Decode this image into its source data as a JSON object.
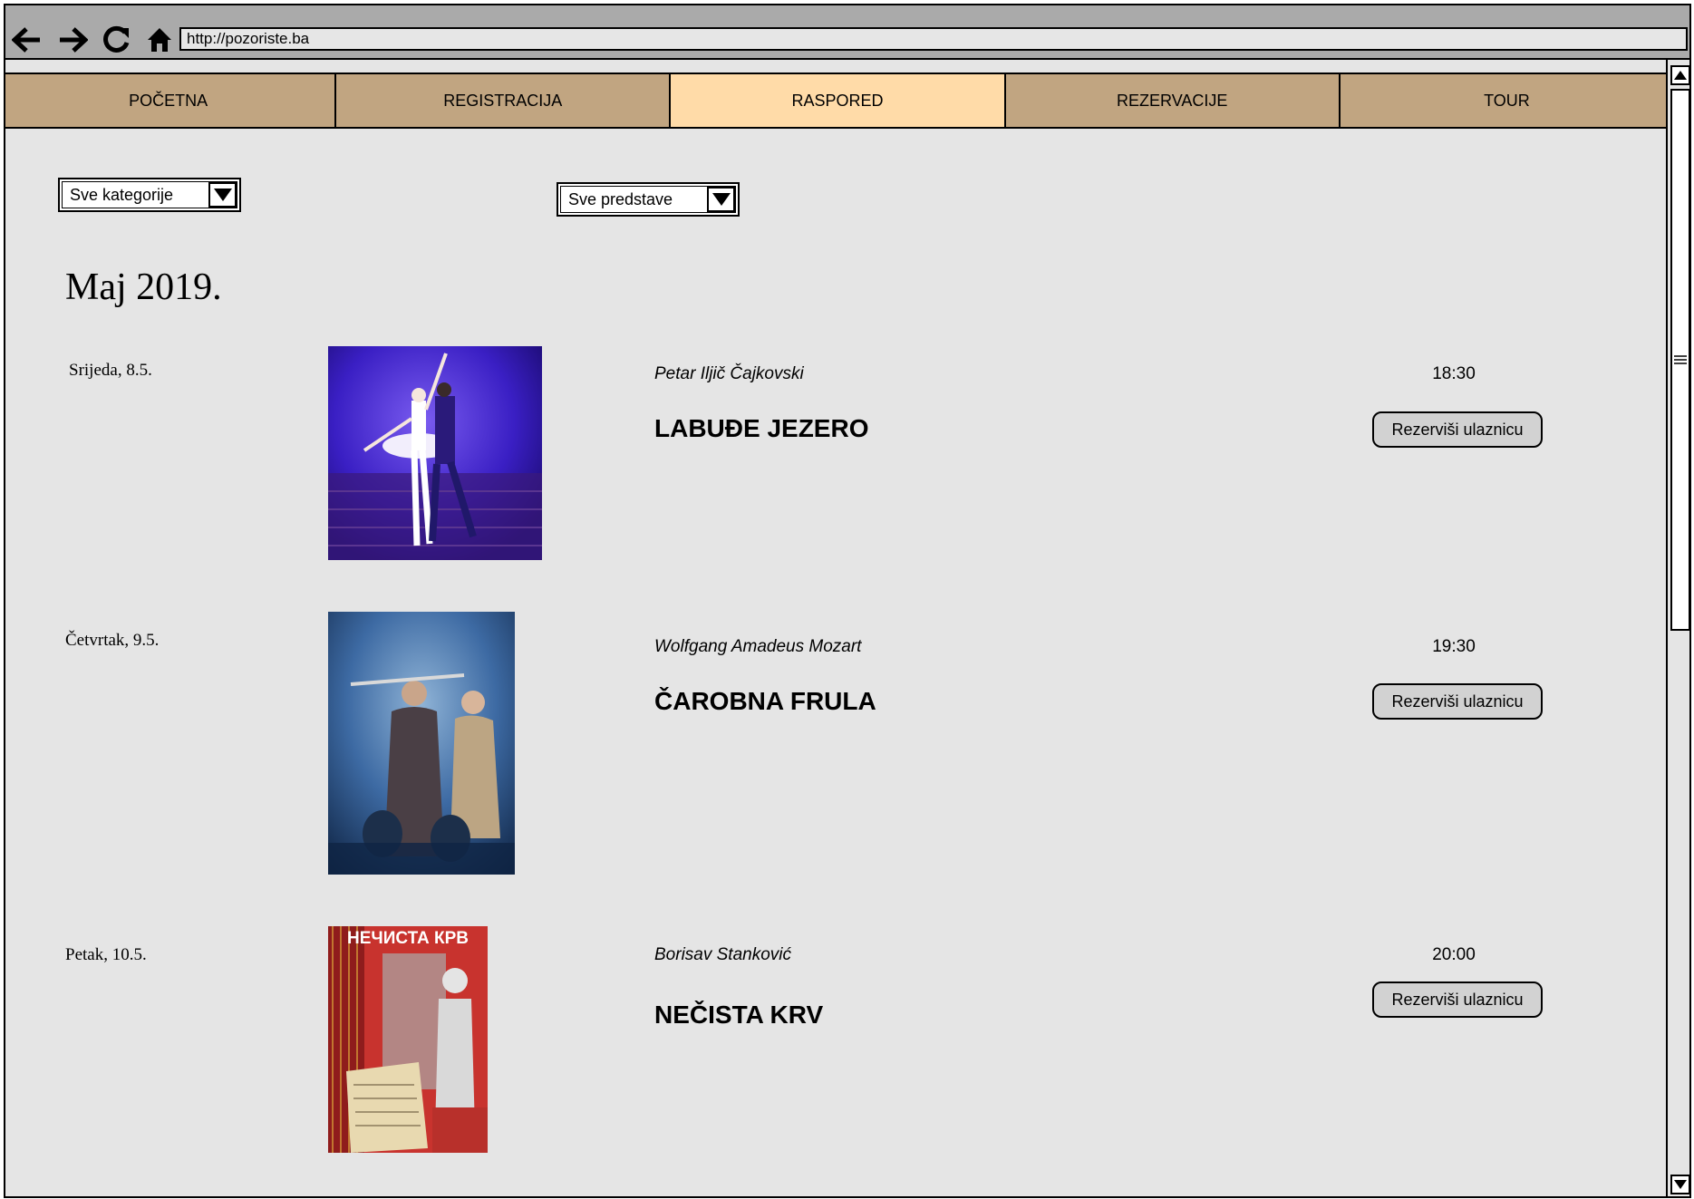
{
  "browser": {
    "url": "http://pozoriste.ba",
    "icons": [
      "back-arrow-icon",
      "forward-arrow-icon",
      "reload-icon",
      "home-icon"
    ]
  },
  "menu": {
    "tabs": [
      {
        "label": "POČETNA",
        "active": false
      },
      {
        "label": "REGISTRACIJA",
        "active": false
      },
      {
        "label": "RASPORED",
        "active": true
      },
      {
        "label": "REZERVACIJE",
        "active": false
      },
      {
        "label": "TOUR",
        "active": false
      }
    ]
  },
  "filters": {
    "category": "Sve kategorije",
    "show": "Sve predstave"
  },
  "month": "Maj 2019.",
  "events": [
    {
      "date": "Srijeda, 8.5.",
      "author": "Petar Iljič Čajkovski",
      "title": "LABUĐE JEZERO",
      "time": "18:30",
      "button": "Rezerviši ulaznicu"
    },
    {
      "date": "Četvrtak, 9.5.",
      "author": "Wolfgang Amadeus Mozart",
      "title": "ČAROBNA FRULA",
      "time": "19:30",
      "button": "Rezerviši ulaznicu"
    },
    {
      "date": "Petak, 10.5.",
      "author": "Borisav Stanković",
      "title": "NEČISTA KRV",
      "time": "20:00",
      "button": "Rezerviši ulaznicu",
      "poster_caption": "НЕЧИСТА КРВ"
    }
  ],
  "colors": {
    "tab": "#c1a581",
    "tab_active": "#ffdba8",
    "page_bg": "#e5e5e5",
    "toolbar_bg": "#aaaaaa"
  }
}
